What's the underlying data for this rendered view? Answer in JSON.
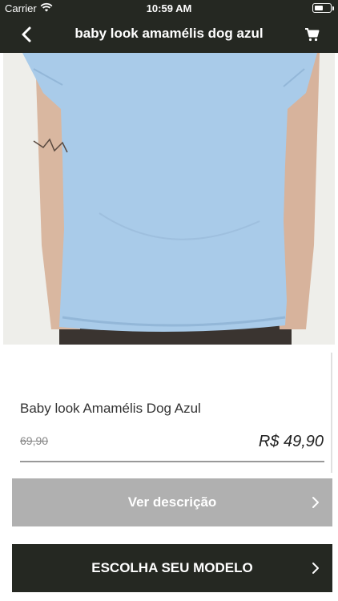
{
  "status_bar": {
    "carrier": "Carrier",
    "time": "10:59 AM",
    "battery_level": 0.55
  },
  "nav": {
    "title": "baby look amamélis dog azul",
    "back_icon": "chevron-left-icon",
    "cart_icon": "cart-icon"
  },
  "product": {
    "name": "Baby look Amamélis Dog Azul",
    "old_price": "69,90",
    "price": "R$ 49,90",
    "shirt_color": "#a9cbe9"
  },
  "actions": {
    "description_label": "Ver descrição",
    "choose_model_label": "ESCOLHA SEU MODELO"
  },
  "colors": {
    "bar_background": "#252822",
    "disabled_button": "#b0b0b0"
  }
}
